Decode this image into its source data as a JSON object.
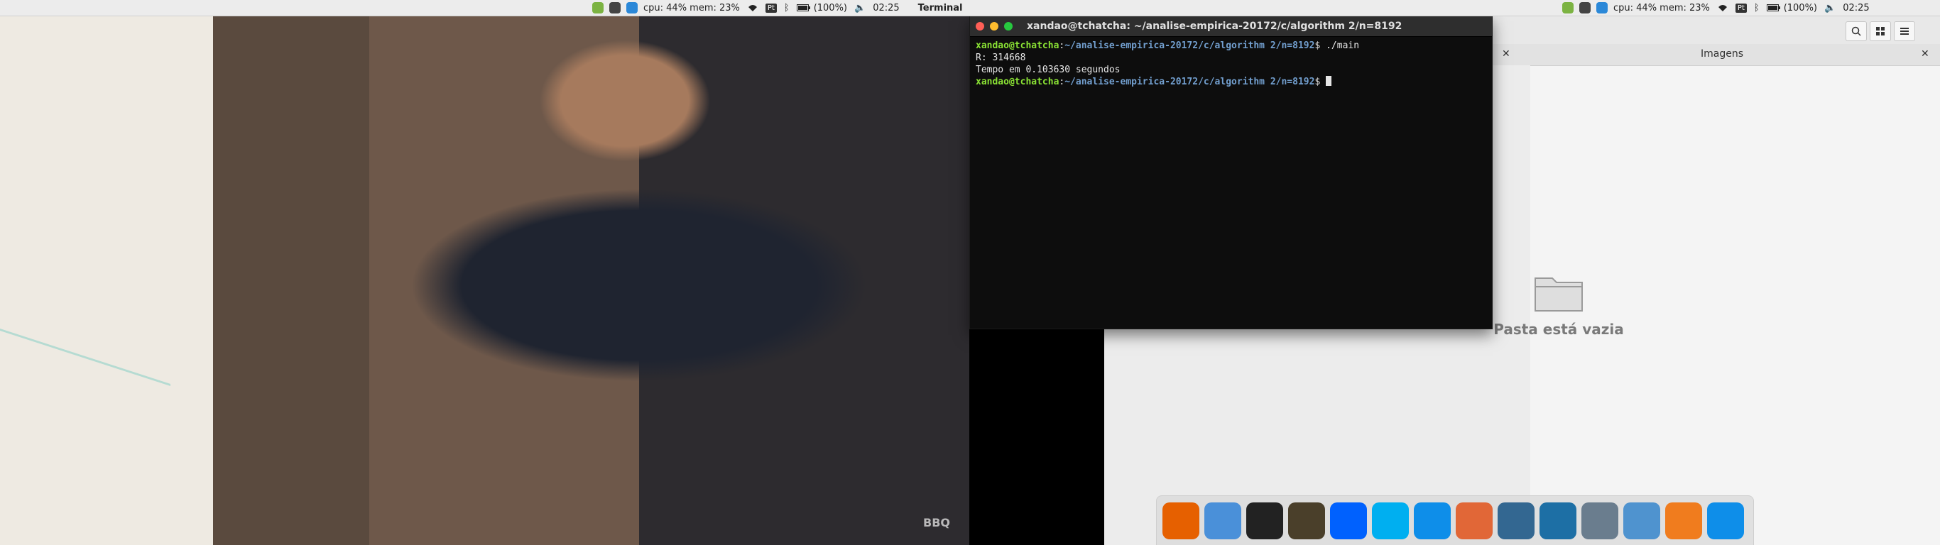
{
  "menubar": {
    "left": {
      "cpu_mem": "cpu: 44% mem: 23%",
      "battery": "(100%)",
      "time": "02:25",
      "app_name": "Terminal",
      "lang": "Pt"
    },
    "right": {
      "cpu_mem": "cpu: 44% mem: 23%",
      "battery": "(100%)",
      "time": "02:25",
      "lang": "Pt"
    }
  },
  "video": {
    "watermark": "BBQ"
  },
  "terminal": {
    "title": "xandao@tchatcha: ~/analise-empirica-20172/c/algorithm 2/n=8192",
    "lines": [
      {
        "user": "xandao@tchatcha",
        "path": "~/analise-empirica-20172/c/algorithm 2/n=8192",
        "cmd": "$ ./main"
      },
      {
        "text": "R: 314668"
      },
      {
        "text": "Tempo em 0.103630 segundos"
      },
      {
        "user": "xandao@tchatcha",
        "path": "~/analise-empirica-20172/c/algorithm 2/n=8192",
        "cmd": "$ "
      }
    ]
  },
  "file_manager": {
    "tab_title": "Imagens",
    "empty_message": "Pasta está vazia"
  },
  "dock": {
    "items": [
      {
        "name": "firefox-icon",
        "color": "#e66000"
      },
      {
        "name": "finder-icon",
        "color": "#4a90d9"
      },
      {
        "name": "terminal-icon",
        "color": "#222222"
      },
      {
        "name": "code-editor-icon",
        "color": "#4a3f2a"
      },
      {
        "name": "dropbox-icon",
        "color": "#0061fe"
      },
      {
        "name": "skype-icon",
        "color": "#00aff0"
      },
      {
        "name": "teamviewer-icon",
        "color": "#0e8ee9"
      },
      {
        "name": "matlab-icon",
        "color": "#e16737"
      },
      {
        "name": "postgres-icon",
        "color": "#336791"
      },
      {
        "name": "mysql-workbench-icon",
        "color": "#1d6fa5"
      },
      {
        "name": "disk-utility-icon",
        "color": "#6a7d8e"
      },
      {
        "name": "virtualbox-icon",
        "color": "#4f93cf"
      },
      {
        "name": "dia-icon",
        "color": "#f07c1e"
      },
      {
        "name": "teamviewer-2-icon",
        "color": "#0e8ee9"
      }
    ]
  }
}
